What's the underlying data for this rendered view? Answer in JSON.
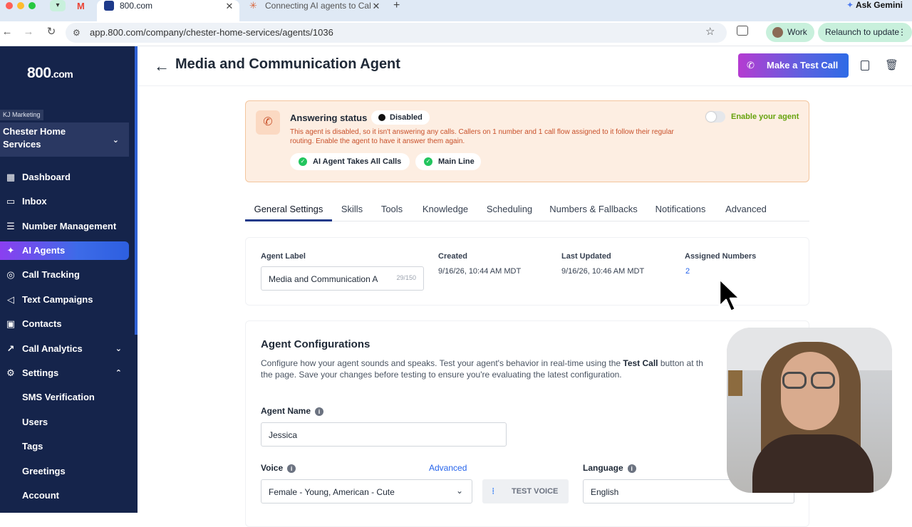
{
  "browser": {
    "tabs": [
      {
        "title": "800.com"
      },
      {
        "title": "Connecting AI agents to Cale"
      }
    ],
    "url": "app.800.com/company/chester-home-services/agents/1036",
    "profile_label": "Work",
    "relaunch_label": "Relaunch to update",
    "ask_gemini_label": "Ask Gemini"
  },
  "sidebar": {
    "logo_main": "800",
    "logo_suffix": ".com",
    "account_badge": "KJ Marketing",
    "company": "Chester Home Services",
    "items": [
      {
        "label": "Dashboard",
        "icon": "grid-icon"
      },
      {
        "label": "Inbox",
        "icon": "inbox-icon"
      },
      {
        "label": "Number Management",
        "icon": "list-icon"
      },
      {
        "label": "AI Agents",
        "icon": "sparkle-icon",
        "active": true
      },
      {
        "label": "Call Tracking",
        "icon": "target-icon"
      },
      {
        "label": "Text Campaigns",
        "icon": "megaphone-icon"
      },
      {
        "label": "Contacts",
        "icon": "contact-icon"
      },
      {
        "label": "Call Analytics",
        "icon": "chart-icon"
      },
      {
        "label": "Settings",
        "icon": "gear-icon"
      },
      {
        "label": "SMS Verification"
      },
      {
        "label": "Users"
      },
      {
        "label": "Tags"
      },
      {
        "label": "Greetings"
      },
      {
        "label": "Account"
      }
    ]
  },
  "header": {
    "title": "Media and Communication Agent",
    "test_call_label": "Make a Test Call"
  },
  "status": {
    "heading": "Answering status",
    "badge": "Disabled",
    "message": "This agent is disabled, so it isn't answering any calls. Callers on 1 number and 1 call flow assigned to it follow their regular routing. Enable the agent to have it answer them again.",
    "toggle_label": "Enable your agent",
    "toggle_on": false,
    "chips": [
      "AI Agent Takes All Calls",
      "Main Line"
    ]
  },
  "tabs": [
    "General Settings",
    "Skills",
    "Tools",
    "Knowledge",
    "Scheduling",
    "Numbers & Fallbacks",
    "Notifications",
    "Advanced"
  ],
  "details": {
    "agent_label_title": "Agent Label",
    "agent_label_value": "Media and Communication A",
    "agent_label_count": "29/150",
    "created_title": "Created",
    "created_value": "9/16/26, 10:44 AM MDT",
    "updated_title": "Last Updated",
    "updated_value": "9/16/26, 10:46 AM MDT",
    "assigned_title": "Assigned Numbers",
    "assigned_value": "2"
  },
  "config": {
    "heading": "Agent Configurations",
    "description_1": "Configure how your agent sounds and speaks. Test your agent's behavior in real-time using the ",
    "description_bold": "Test Call",
    "description_2": " button at th",
    "description_3": "the page. Save your changes before testing to ensure you're evaluating the latest configuration.",
    "agent_name_label": "Agent Name",
    "agent_name_value": "Jessica",
    "voice_label": "Voice",
    "voice_advanced": "Advanced",
    "voice_value": "Female - Young, American - Cute",
    "test_voice_label": "TEST VOICE",
    "language_label": "Language",
    "language_value": "English"
  },
  "colors": {
    "sidebar_bg": "#15244b",
    "accent_purple": "#8b3ff0",
    "accent_blue": "#2d5fe0",
    "status_bg": "#fdeee2",
    "status_text": "#c8502a",
    "success": "#22c55e"
  }
}
